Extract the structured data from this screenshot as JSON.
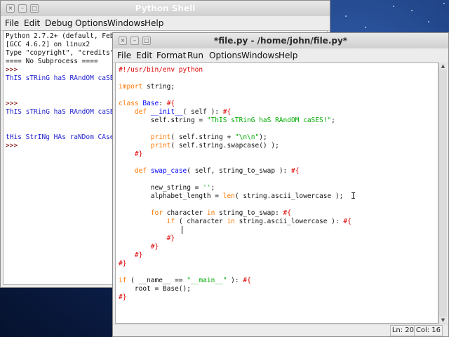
{
  "shell": {
    "title": "Python Shell",
    "menu": [
      "File",
      "Edit",
      "Debug",
      "Options",
      "Windows",
      "Help"
    ],
    "lines": [
      {
        "text": "Python 2.7.2+ (default, Feb",
        "kind": "out"
      },
      {
        "text": "[GCC 4.6.2] on linux2",
        "kind": "out"
      },
      {
        "text": "Type \"copyright\", \"credits\"",
        "kind": "out"
      },
      {
        "text": "==== No Subprocess ====",
        "kind": "out"
      },
      {
        "text": ">>>",
        "kind": "prompt"
      },
      {
        "text": "ThIS sTRinG haS RAndOM caSE",
        "kind": "blue"
      },
      {
        "text": "",
        "kind": "out"
      },
      {
        "text": "",
        "kind": "out"
      },
      {
        "text": ">>>",
        "kind": "prompt"
      },
      {
        "text": "ThIS sTRinG haS RAndOM caSE",
        "kind": "blue"
      },
      {
        "text": "",
        "kind": "out"
      },
      {
        "text": "",
        "kind": "out"
      },
      {
        "text": "tHis StrINg HAs raNDom CAse",
        "kind": "blue"
      },
      {
        "text": ">>>",
        "kind": "prompt"
      }
    ]
  },
  "editor": {
    "title": "*file.py - /home/john/file.py*",
    "menu": [
      "File",
      "Edit",
      "Format",
      "Run",
      "Options",
      "Windows",
      "Help"
    ],
    "status": {
      "line": "Ln: 20",
      "col": "Col: 16"
    },
    "code": [
      [
        [
          "#!/usr/bin/env python",
          "m"
        ]
      ],
      [],
      [
        [
          "import",
          "k"
        ],
        [
          " string;",
          "t"
        ]
      ],
      [],
      [
        [
          "class",
          "k"
        ],
        [
          " ",
          "t"
        ],
        [
          "Base",
          "d"
        ],
        [
          ": ",
          "t"
        ],
        [
          "#{",
          "m"
        ]
      ],
      [
        [
          "    ",
          "t"
        ],
        [
          "def",
          "k"
        ],
        [
          " ",
          "t"
        ],
        [
          "__init__",
          "d"
        ],
        [
          "( self ): ",
          "t"
        ],
        [
          "#{",
          "m"
        ]
      ],
      [
        [
          "        self.string = ",
          "t"
        ],
        [
          "\"ThIS sTRinG haS RAndOM caSES!\"",
          "s"
        ],
        [
          ";",
          "t"
        ]
      ],
      [],
      [
        [
          "        ",
          "t"
        ],
        [
          "print",
          "k"
        ],
        [
          "( self.string + ",
          "t"
        ],
        [
          "\"\\n\\n\"",
          "s"
        ],
        [
          ");",
          "t"
        ]
      ],
      [
        [
          "        ",
          "t"
        ],
        [
          "print",
          "k"
        ],
        [
          "( self.string.swapcase() );",
          "t"
        ]
      ],
      [
        [
          "    ",
          "t"
        ],
        [
          "#}",
          "m"
        ]
      ],
      [],
      [
        [
          "    ",
          "t"
        ],
        [
          "def",
          "k"
        ],
        [
          " ",
          "t"
        ],
        [
          "swap_case",
          "d"
        ],
        [
          "( self, string_to_swap ): ",
          "t"
        ],
        [
          "#{",
          "m"
        ]
      ],
      [],
      [
        [
          "        new_string = ",
          "t"
        ],
        [
          "''",
          "s"
        ],
        [
          ";",
          "t"
        ]
      ],
      [
        [
          "        alphabet_length = ",
          "t"
        ],
        [
          "len",
          "k"
        ],
        [
          "( string.ascii_lowercase );",
          "t"
        ]
      ],
      [],
      [
        [
          "        ",
          "t"
        ],
        [
          "for",
          "k"
        ],
        [
          " character ",
          "t"
        ],
        [
          "in",
          "k"
        ],
        [
          " string_to_swap: ",
          "t"
        ],
        [
          "#{",
          "m"
        ]
      ],
      [
        [
          "            ",
          "t"
        ],
        [
          "if",
          "k"
        ],
        [
          " ( character ",
          "t"
        ],
        [
          "in",
          "k"
        ],
        [
          " string.ascii_lowercase ): ",
          "t"
        ],
        [
          "#{",
          "m"
        ]
      ],
      [],
      [
        [
          "            ",
          "t"
        ],
        [
          "#}",
          "m"
        ]
      ],
      [
        [
          "        ",
          "t"
        ],
        [
          "#}",
          "m"
        ]
      ],
      [
        [
          "    ",
          "t"
        ],
        [
          "#}",
          "m"
        ]
      ],
      [
        [
          "#}",
          "m"
        ]
      ],
      [],
      [
        [
          "if",
          "k"
        ],
        [
          " ( __name__ == ",
          "t"
        ],
        [
          "\"__main__\"",
          "s"
        ],
        [
          " ): ",
          "t"
        ],
        [
          "#{",
          "m"
        ]
      ],
      [
        [
          "    root = Base();",
          "t"
        ]
      ],
      [
        [
          "#}",
          "m"
        ]
      ]
    ]
  },
  "icons": {
    "minimize": "minimize-icon",
    "maximize": "maximize-icon",
    "close": "close-icon"
  }
}
